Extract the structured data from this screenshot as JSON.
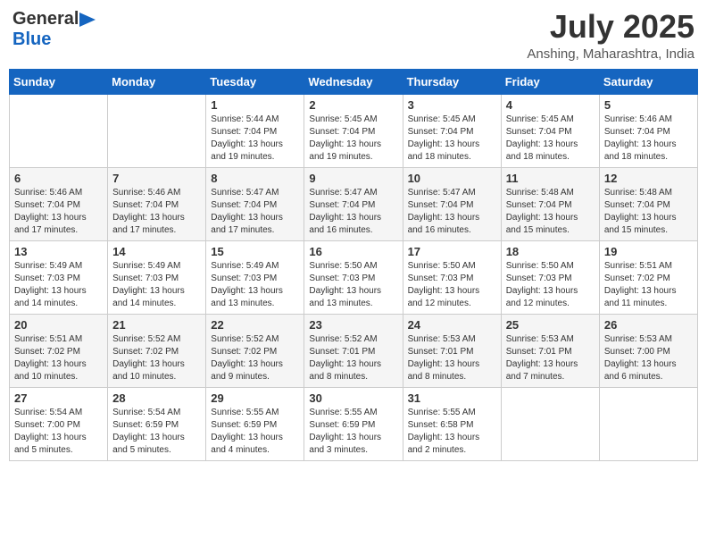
{
  "header": {
    "logo_general": "General",
    "logo_blue": "Blue",
    "month_year": "July 2025",
    "location": "Anshing, Maharashtra, India"
  },
  "calendar": {
    "days_header": [
      "Sunday",
      "Monday",
      "Tuesday",
      "Wednesday",
      "Thursday",
      "Friday",
      "Saturday"
    ],
    "weeks": [
      [
        {
          "day": "",
          "sunrise": "",
          "sunset": "",
          "daylight": ""
        },
        {
          "day": "",
          "sunrise": "",
          "sunset": "",
          "daylight": ""
        },
        {
          "day": "1",
          "sunrise": "Sunrise: 5:44 AM",
          "sunset": "Sunset: 7:04 PM",
          "daylight": "Daylight: 13 hours and 19 minutes."
        },
        {
          "day": "2",
          "sunrise": "Sunrise: 5:45 AM",
          "sunset": "Sunset: 7:04 PM",
          "daylight": "Daylight: 13 hours and 19 minutes."
        },
        {
          "day": "3",
          "sunrise": "Sunrise: 5:45 AM",
          "sunset": "Sunset: 7:04 PM",
          "daylight": "Daylight: 13 hours and 18 minutes."
        },
        {
          "day": "4",
          "sunrise": "Sunrise: 5:45 AM",
          "sunset": "Sunset: 7:04 PM",
          "daylight": "Daylight: 13 hours and 18 minutes."
        },
        {
          "day": "5",
          "sunrise": "Sunrise: 5:46 AM",
          "sunset": "Sunset: 7:04 PM",
          "daylight": "Daylight: 13 hours and 18 minutes."
        }
      ],
      [
        {
          "day": "6",
          "sunrise": "Sunrise: 5:46 AM",
          "sunset": "Sunset: 7:04 PM",
          "daylight": "Daylight: 13 hours and 17 minutes."
        },
        {
          "day": "7",
          "sunrise": "Sunrise: 5:46 AM",
          "sunset": "Sunset: 7:04 PM",
          "daylight": "Daylight: 13 hours and 17 minutes."
        },
        {
          "day": "8",
          "sunrise": "Sunrise: 5:47 AM",
          "sunset": "Sunset: 7:04 PM",
          "daylight": "Daylight: 13 hours and 17 minutes."
        },
        {
          "day": "9",
          "sunrise": "Sunrise: 5:47 AM",
          "sunset": "Sunset: 7:04 PM",
          "daylight": "Daylight: 13 hours and 16 minutes."
        },
        {
          "day": "10",
          "sunrise": "Sunrise: 5:47 AM",
          "sunset": "Sunset: 7:04 PM",
          "daylight": "Daylight: 13 hours and 16 minutes."
        },
        {
          "day": "11",
          "sunrise": "Sunrise: 5:48 AM",
          "sunset": "Sunset: 7:04 PM",
          "daylight": "Daylight: 13 hours and 15 minutes."
        },
        {
          "day": "12",
          "sunrise": "Sunrise: 5:48 AM",
          "sunset": "Sunset: 7:04 PM",
          "daylight": "Daylight: 13 hours and 15 minutes."
        }
      ],
      [
        {
          "day": "13",
          "sunrise": "Sunrise: 5:49 AM",
          "sunset": "Sunset: 7:03 PM",
          "daylight": "Daylight: 13 hours and 14 minutes."
        },
        {
          "day": "14",
          "sunrise": "Sunrise: 5:49 AM",
          "sunset": "Sunset: 7:03 PM",
          "daylight": "Daylight: 13 hours and 14 minutes."
        },
        {
          "day": "15",
          "sunrise": "Sunrise: 5:49 AM",
          "sunset": "Sunset: 7:03 PM",
          "daylight": "Daylight: 13 hours and 13 minutes."
        },
        {
          "day": "16",
          "sunrise": "Sunrise: 5:50 AM",
          "sunset": "Sunset: 7:03 PM",
          "daylight": "Daylight: 13 hours and 13 minutes."
        },
        {
          "day": "17",
          "sunrise": "Sunrise: 5:50 AM",
          "sunset": "Sunset: 7:03 PM",
          "daylight": "Daylight: 13 hours and 12 minutes."
        },
        {
          "day": "18",
          "sunrise": "Sunrise: 5:50 AM",
          "sunset": "Sunset: 7:03 PM",
          "daylight": "Daylight: 13 hours and 12 minutes."
        },
        {
          "day": "19",
          "sunrise": "Sunrise: 5:51 AM",
          "sunset": "Sunset: 7:02 PM",
          "daylight": "Daylight: 13 hours and 11 minutes."
        }
      ],
      [
        {
          "day": "20",
          "sunrise": "Sunrise: 5:51 AM",
          "sunset": "Sunset: 7:02 PM",
          "daylight": "Daylight: 13 hours and 10 minutes."
        },
        {
          "day": "21",
          "sunrise": "Sunrise: 5:52 AM",
          "sunset": "Sunset: 7:02 PM",
          "daylight": "Daylight: 13 hours and 10 minutes."
        },
        {
          "day": "22",
          "sunrise": "Sunrise: 5:52 AM",
          "sunset": "Sunset: 7:02 PM",
          "daylight": "Daylight: 13 hours and 9 minutes."
        },
        {
          "day": "23",
          "sunrise": "Sunrise: 5:52 AM",
          "sunset": "Sunset: 7:01 PM",
          "daylight": "Daylight: 13 hours and 8 minutes."
        },
        {
          "day": "24",
          "sunrise": "Sunrise: 5:53 AM",
          "sunset": "Sunset: 7:01 PM",
          "daylight": "Daylight: 13 hours and 8 minutes."
        },
        {
          "day": "25",
          "sunrise": "Sunrise: 5:53 AM",
          "sunset": "Sunset: 7:01 PM",
          "daylight": "Daylight: 13 hours and 7 minutes."
        },
        {
          "day": "26",
          "sunrise": "Sunrise: 5:53 AM",
          "sunset": "Sunset: 7:00 PM",
          "daylight": "Daylight: 13 hours and 6 minutes."
        }
      ],
      [
        {
          "day": "27",
          "sunrise": "Sunrise: 5:54 AM",
          "sunset": "Sunset: 7:00 PM",
          "daylight": "Daylight: 13 hours and 5 minutes."
        },
        {
          "day": "28",
          "sunrise": "Sunrise: 5:54 AM",
          "sunset": "Sunset: 6:59 PM",
          "daylight": "Daylight: 13 hours and 5 minutes."
        },
        {
          "day": "29",
          "sunrise": "Sunrise: 5:55 AM",
          "sunset": "Sunset: 6:59 PM",
          "daylight": "Daylight: 13 hours and 4 minutes."
        },
        {
          "day": "30",
          "sunrise": "Sunrise: 5:55 AM",
          "sunset": "Sunset: 6:59 PM",
          "daylight": "Daylight: 13 hours and 3 minutes."
        },
        {
          "day": "31",
          "sunrise": "Sunrise: 5:55 AM",
          "sunset": "Sunset: 6:58 PM",
          "daylight": "Daylight: 13 hours and 2 minutes."
        },
        {
          "day": "",
          "sunrise": "",
          "sunset": "",
          "daylight": ""
        },
        {
          "day": "",
          "sunrise": "",
          "sunset": "",
          "daylight": ""
        }
      ]
    ]
  }
}
